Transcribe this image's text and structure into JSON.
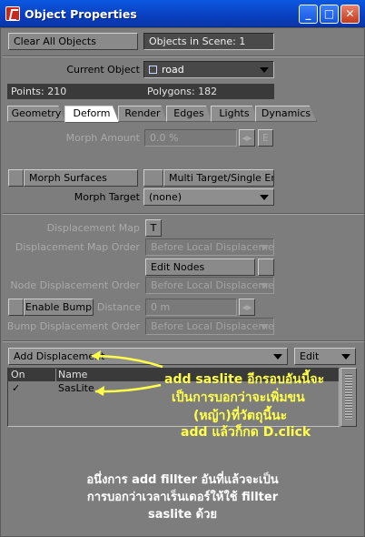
{
  "window": {
    "title": "Object Properties",
    "min": "_",
    "max": "□",
    "close": "✕"
  },
  "toolbar": {
    "clear_all": "Clear All Objects",
    "objects_in_scene": "Objects in Scene: 1"
  },
  "object": {
    "label": "Current Object",
    "value": "road",
    "points": "Points: 210",
    "polygons": "Polygons: 182"
  },
  "tabs": [
    "Geometry",
    "Deform",
    "Render",
    "Edges",
    "Lights",
    "Dynamics"
  ],
  "deform": {
    "morph_amount_label": "Morph Amount",
    "morph_amount_value": "0.0 %",
    "e_button": "E",
    "morph_surfaces": "Morph Surfaces",
    "multi_target": "Multi Target/Single Env",
    "morph_target_label": "Morph Target",
    "morph_target_value": "(none)",
    "displacement_map_label": "Displacement Map",
    "t_button": "T",
    "displacement_map_order_label": "Displacement Map Order",
    "displacement_map_order_value": "Before Local Displaceme...",
    "edit_nodes": "Edit Nodes",
    "node_displacement_order_label": "Node Displacement Order",
    "node_displacement_order_value": "Before Local Displaceme...",
    "enable_bump": "Enable Bump",
    "distance_label": "Distance",
    "distance_value": "0 m",
    "bump_displacement_order_label": "Bump Displacement Order",
    "bump_displacement_order_value": "Before Local Displaceme..."
  },
  "displacement": {
    "add_label": "Add Displacement",
    "edit_label": "Edit",
    "columns": [
      "On",
      "Name"
    ],
    "rows": [
      {
        "on": "✓",
        "name": "SasLite"
      }
    ]
  },
  "annotation": {
    "lines": [
      "add saslite อีกรอบอันนี้จะ",
      "เป็นการบอกว่าจะเพิ่มขน",
      "(หญ้า)ที่วัตถุนี้นะ",
      "add แล้วก็กด D.click"
    ]
  },
  "note": {
    "lines": [
      "อนึ่งการ add fillter อันที่แล้วจะเป็น",
      "การบอกว่าเวลาเร็นเดอร์ให้ใช้ fillter",
      "saslite ด้วย"
    ]
  },
  "colors": {
    "titlebar": "#0a58e0",
    "panel": "#7d7d7d",
    "annotation": "#ffff4a"
  }
}
